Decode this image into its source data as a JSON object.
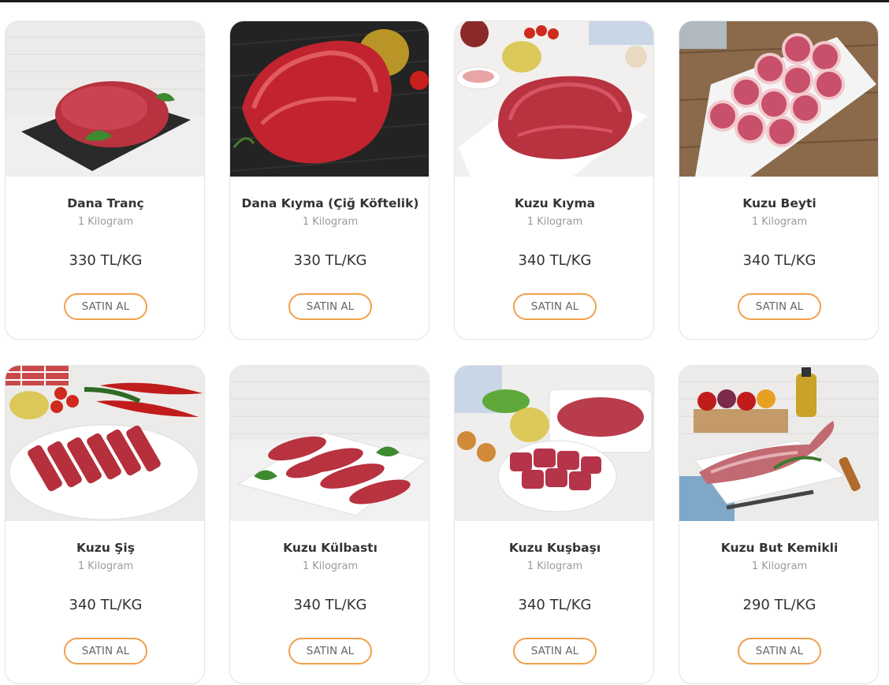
{
  "accent_color": "#f0a04b",
  "products": [
    {
      "name": "Dana Tranç",
      "unit": "1 Kilogram",
      "price": "330 TL/KG",
      "button": "SATIN AL"
    },
    {
      "name": "Dana Kıyma (Çiğ Köftelik)",
      "unit": "1 Kilogram",
      "price": "330 TL/KG",
      "button": "SATIN AL"
    },
    {
      "name": "Kuzu Kıyma",
      "unit": "1 Kilogram",
      "price": "340 TL/KG",
      "button": "SATIN AL"
    },
    {
      "name": "Kuzu Beyti",
      "unit": "1 Kilogram",
      "price": "340 TL/KG",
      "button": "SATIN AL"
    },
    {
      "name": "Kuzu Şiş",
      "unit": "1 Kilogram",
      "price": "340 TL/KG",
      "button": "SATIN AL"
    },
    {
      "name": "Kuzu Külbastı",
      "unit": "1 Kilogram",
      "price": "340 TL/KG",
      "button": "SATIN AL"
    },
    {
      "name": "Kuzu Kuşbaşı",
      "unit": "1 Kilogram",
      "price": "340 TL/KG",
      "button": "SATIN AL"
    },
    {
      "name": "Kuzu But Kemikli",
      "unit": "1 Kilogram",
      "price": "290 TL/KG",
      "button": "SATIN AL"
    }
  ]
}
